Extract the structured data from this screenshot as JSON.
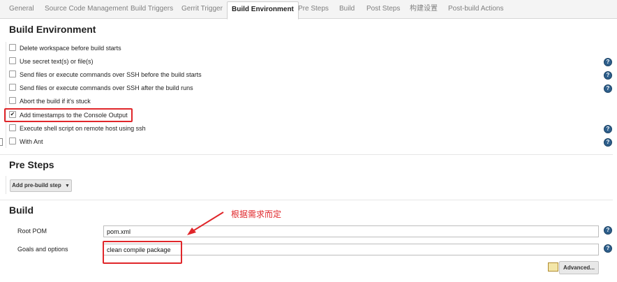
{
  "tabs": [
    "General",
    "Source Code Management",
    "Build Triggers",
    "Gerrit Trigger",
    "Build Environment",
    "Pre Steps",
    "Build",
    "Post Steps",
    "构建设置",
    "Post-build Actions"
  ],
  "build_environment": {
    "title": "Build Environment",
    "options": [
      {
        "label": "Delete workspace before build starts",
        "checked": false,
        "help": false
      },
      {
        "label": "Use secret text(s) or file(s)",
        "checked": false,
        "help": true
      },
      {
        "label": "Send files or execute commands over SSH before the build starts",
        "checked": false,
        "help": true
      },
      {
        "label": "Send files or execute commands over SSH after the build runs",
        "checked": false,
        "help": true
      },
      {
        "label": "Abort the build if it's stuck",
        "checked": false,
        "help": false
      },
      {
        "label": "Add timestamps to the Console Output",
        "checked": true,
        "help": false
      },
      {
        "label": "Execute shell script on remote host using ssh",
        "checked": false,
        "help": true
      },
      {
        "label": "With Ant",
        "checked": false,
        "help": true
      }
    ]
  },
  "pre_steps": {
    "title": "Pre Steps",
    "add_button": "Add pre-build step"
  },
  "build": {
    "title": "Build",
    "root_pom_label": "Root POM",
    "root_pom_value": "pom.xml",
    "goals_label": "Goals and options",
    "goals_value": "clean compile package",
    "advanced_button": "Advanced..."
  },
  "annotation": "根据需求而定",
  "colors": {
    "highlight": "#e0262a",
    "help_icon": "#2e5f8c"
  }
}
